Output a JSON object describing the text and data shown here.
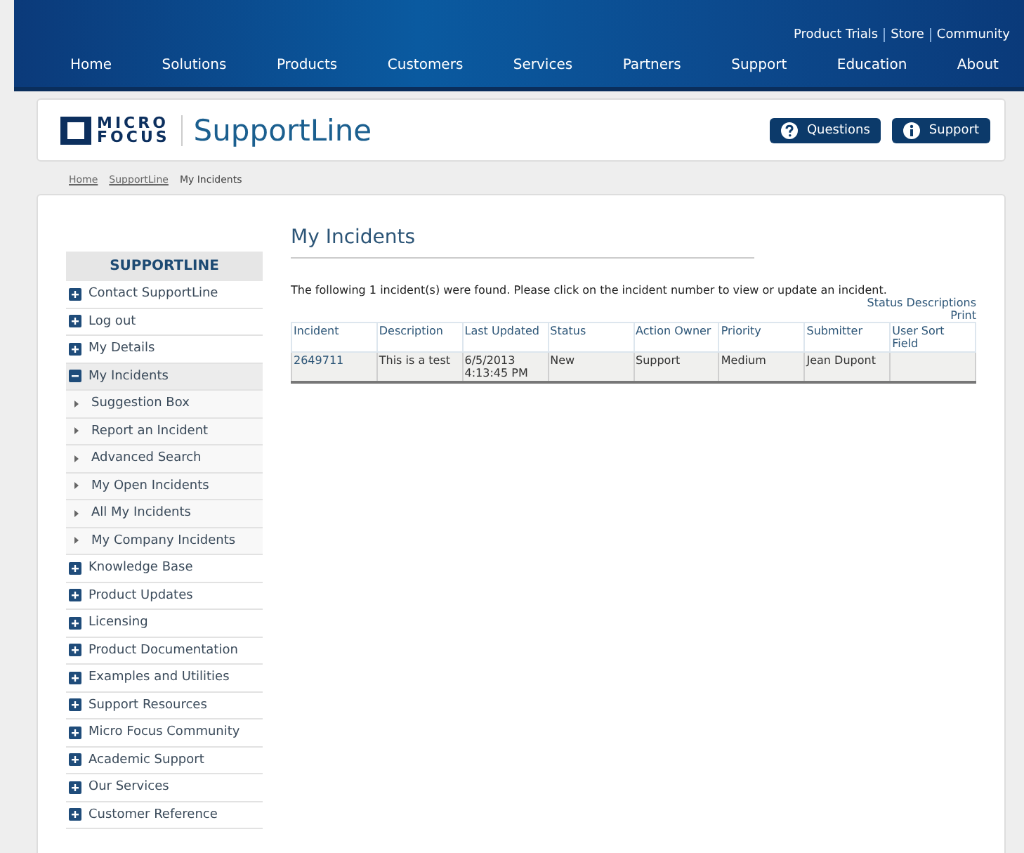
{
  "top_links": [
    "Product Trials",
    "Store",
    "Community"
  ],
  "nav": [
    "Home",
    "Solutions",
    "Products",
    "Customers",
    "Services",
    "Partners",
    "Support",
    "Education",
    "About"
  ],
  "header": {
    "logo_line1": "MICRO",
    "logo_line2": "FOCUS",
    "title": "SupportLine",
    "buttons": [
      {
        "label": "Questions",
        "kind": "question"
      },
      {
        "label": "Support",
        "kind": "info"
      }
    ]
  },
  "breadcrumb": [
    {
      "label": "Home",
      "kind": "link"
    },
    {
      "label": "SupportLine",
      "kind": "link"
    },
    {
      "label": "My Incidents",
      "kind": "current"
    }
  ],
  "sidebar": {
    "title": "SUPPORTLINE",
    "items": [
      {
        "label": "Contact SupportLine",
        "expanded": false,
        "selected": false
      },
      {
        "label": "Log out",
        "expanded": false,
        "selected": false
      },
      {
        "label": "My Details",
        "expanded": false,
        "selected": false
      },
      {
        "label": "My Incidents",
        "expanded": true,
        "selected": true,
        "children": [
          {
            "label": "Suggestion Box"
          },
          {
            "label": "Report an Incident"
          },
          {
            "label": "Advanced Search"
          },
          {
            "label": "My Open Incidents"
          },
          {
            "label": "All My Incidents"
          },
          {
            "label": "My Company Incidents"
          }
        ]
      },
      {
        "label": "Knowledge Base",
        "expanded": false,
        "selected": false
      },
      {
        "label": "Product Updates",
        "expanded": false,
        "selected": false
      },
      {
        "label": "Licensing",
        "expanded": false,
        "selected": false
      },
      {
        "label": "Product Documentation",
        "expanded": false,
        "selected": false
      },
      {
        "label": "Examples and Utilities",
        "expanded": false,
        "selected": false
      },
      {
        "label": "Support Resources",
        "expanded": false,
        "selected": false
      },
      {
        "label": "Micro Focus Community",
        "expanded": false,
        "selected": false
      },
      {
        "label": "Academic Support",
        "expanded": false,
        "selected": false
      },
      {
        "label": "Our Services",
        "expanded": false,
        "selected": false
      },
      {
        "label": "Customer Reference",
        "expanded": false,
        "selected": false
      }
    ]
  },
  "main": {
    "heading": "My Incidents",
    "intro": "The following 1 incident(s) were found. Please click on the incident number to view or update an incident.",
    "links": [
      "Status Descriptions",
      "Print"
    ],
    "table": {
      "columns": [
        "Incident",
        "Description",
        "Last Updated",
        "Status",
        "Action Owner",
        "Priority",
        "Submitter",
        "User Sort Field"
      ],
      "rows": [
        [
          "2649711",
          "This is a test",
          "6/5/2013 4:13:45 PM",
          "New",
          "Support",
          "Medium",
          "Jean Dupont",
          ""
        ]
      ]
    }
  }
}
